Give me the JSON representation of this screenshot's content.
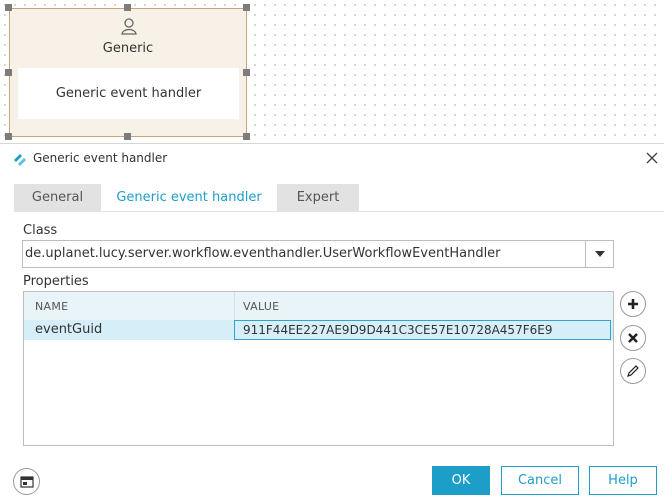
{
  "canvas": {
    "node": {
      "title": "Generic",
      "body": "Generic event handler",
      "icon": "user-icon"
    }
  },
  "dialog": {
    "title": "Generic event handler",
    "tabs": [
      {
        "label": "General",
        "active": false
      },
      {
        "label": "Generic event handler",
        "active": true
      },
      {
        "label": "Expert",
        "active": false
      }
    ],
    "class_label": "Class",
    "class_value": "de.uplanet.lucy.server.workflow.eventhandler.UserWorkflowEventHandler",
    "properties_label": "Properties",
    "table": {
      "columns": [
        "NAME",
        "VALUE"
      ],
      "rows": [
        {
          "name": "eventGuid",
          "value": "911F44EE227AE9D9D441C3CE57E10728A457F6E9"
        }
      ]
    },
    "side_buttons": [
      "add-icon",
      "remove-icon",
      "edit-icon"
    ],
    "buttons": {
      "ok": "OK",
      "cancel": "Cancel",
      "help": "Help"
    }
  },
  "colors": {
    "accent": "#1d9ec9",
    "node_fill": "#f7f1e8",
    "node_border": "#c8a577",
    "selected_row": "#d6eef8"
  }
}
